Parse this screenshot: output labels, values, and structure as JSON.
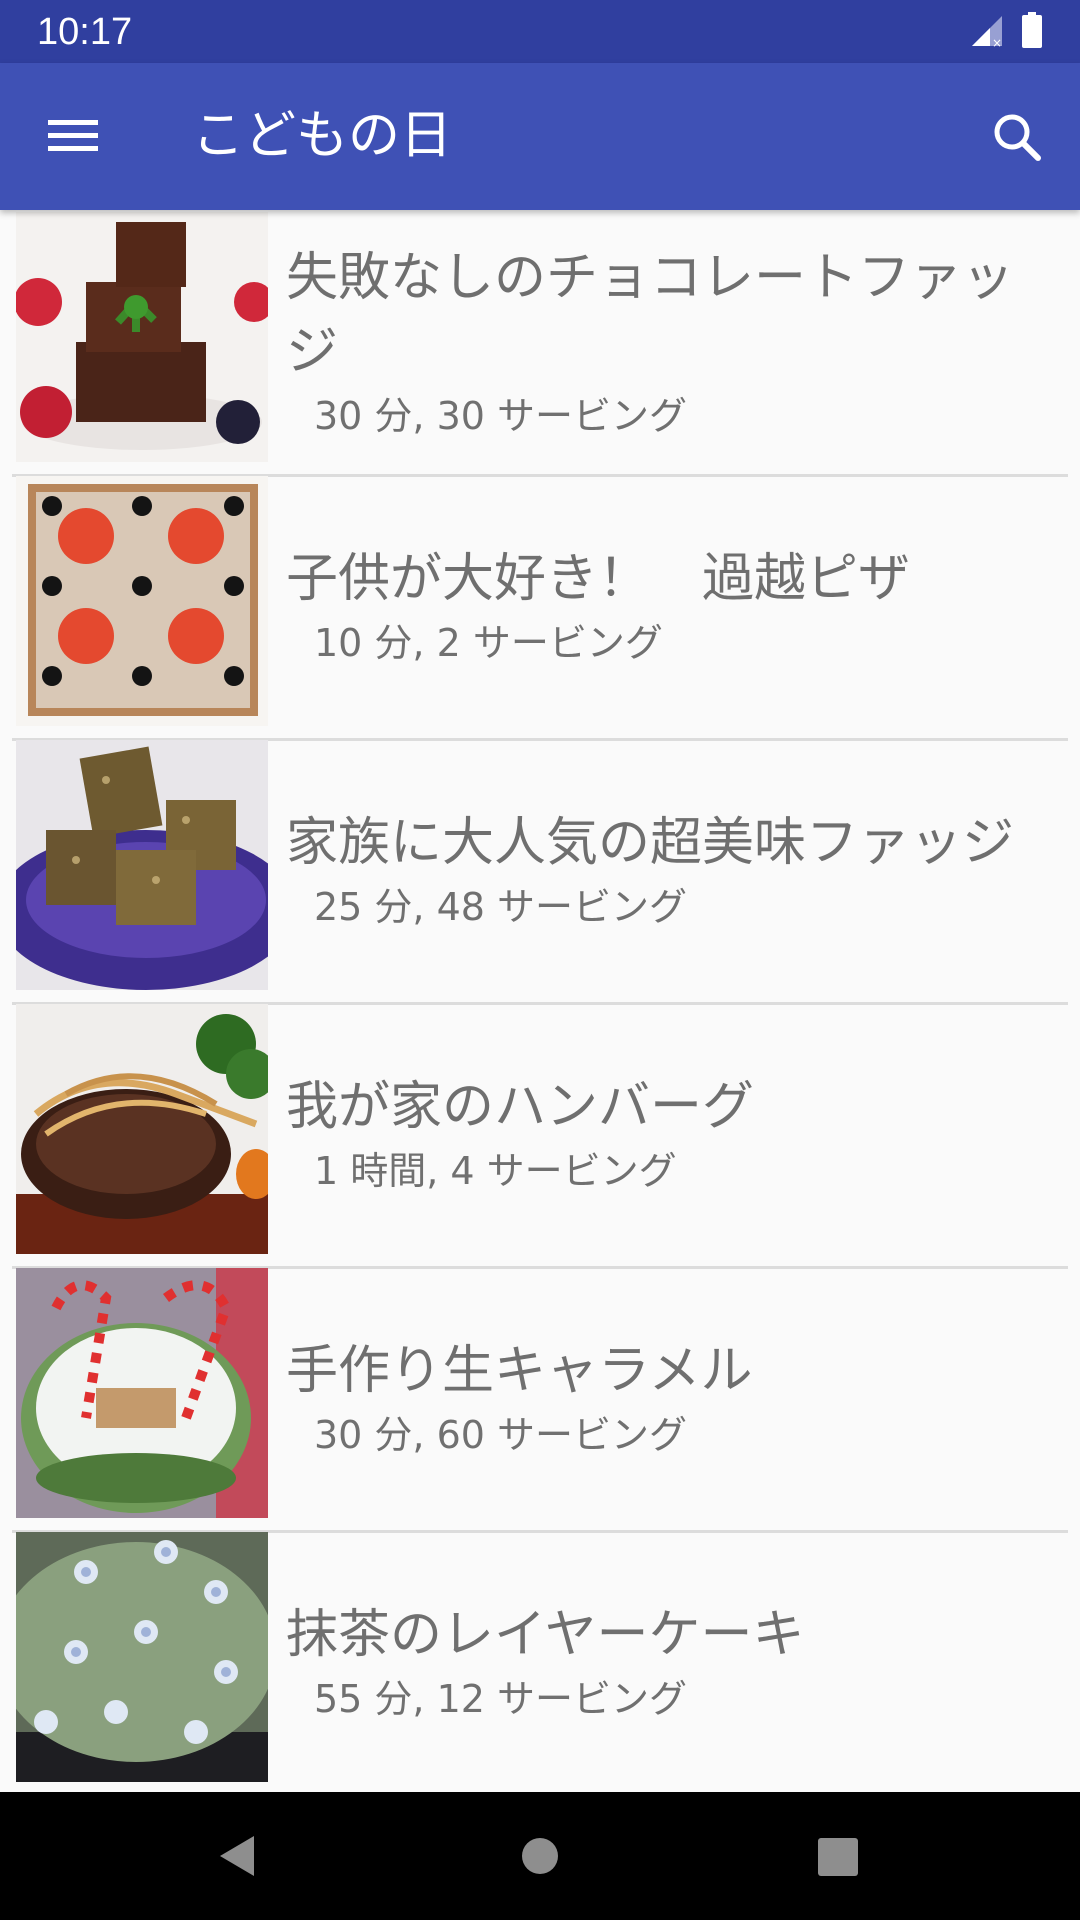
{
  "status_bar": {
    "time": "10:17",
    "signal_icon": "signal-no-data-icon",
    "battery_icon": "battery-full-icon"
  },
  "app_bar": {
    "title": "こどもの日",
    "menu_icon": "hamburger-menu-icon",
    "search_icon": "search-icon",
    "color": "#3f51b5"
  },
  "recipes": [
    {
      "title": "失敗なしのチョコレートファッジ",
      "meta": "30 分, 30 サービング",
      "image": "chocolate-fudge-photo"
    },
    {
      "title": "子供が大好き！　過越ピザ",
      "meta": "10 分, 2 サービング",
      "image": "matzo-pizza-photo"
    },
    {
      "title": "家族に大人気の超美味ファッジ",
      "meta": "25 分, 48 サービング",
      "image": "fudge-on-plate-photo"
    },
    {
      "title": "我が家のハンバーグ",
      "meta": "1 時間, 4 サービング",
      "image": "hamburg-steak-photo"
    },
    {
      "title": "手作り生キャラメル",
      "meta": "30 分, 60 サービング",
      "image": "caramel-candy-cane-photo"
    },
    {
      "title": "抹茶のレイヤーケーキ",
      "meta": "55 分, 12 サービング",
      "image": "matcha-cake-photo"
    }
  ],
  "nav_bar": {
    "back_icon": "back-triangle-icon",
    "home_icon": "home-circle-icon",
    "recents_icon": "recents-square-icon"
  }
}
